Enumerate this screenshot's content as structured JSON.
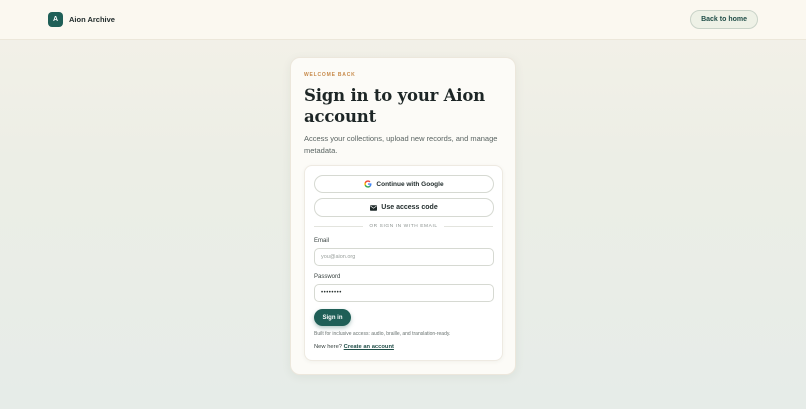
{
  "header": {
    "logo_letter": "A",
    "app_name": "Aion Archive",
    "back_label": "Back to home"
  },
  "card": {
    "eyebrow": "WELCOME BACK",
    "title": "Sign in to your Aion account",
    "subtitle": "Access your collections, upload new records, and manage metadata."
  },
  "auth": {
    "google_label": "Continue with Google",
    "access_code_label": "Use access code",
    "divider_text": "OR SIGN IN WITH EMAIL",
    "email_label": "Email",
    "email_placeholder": "you@aion.org",
    "password_label": "Password",
    "password_value": "••••••••",
    "signin_label": "Sign in",
    "note": "Built for inclusive access: audio, braille, and translation-ready.",
    "new_here": "New here?",
    "create_account": "Create an account"
  },
  "colors": {
    "brand": "#1f5f57",
    "eyebrow": "#c78a4a",
    "background": "#eceee6"
  },
  "icons": {
    "google": "google-icon",
    "access_code": "envelope-icon"
  }
}
